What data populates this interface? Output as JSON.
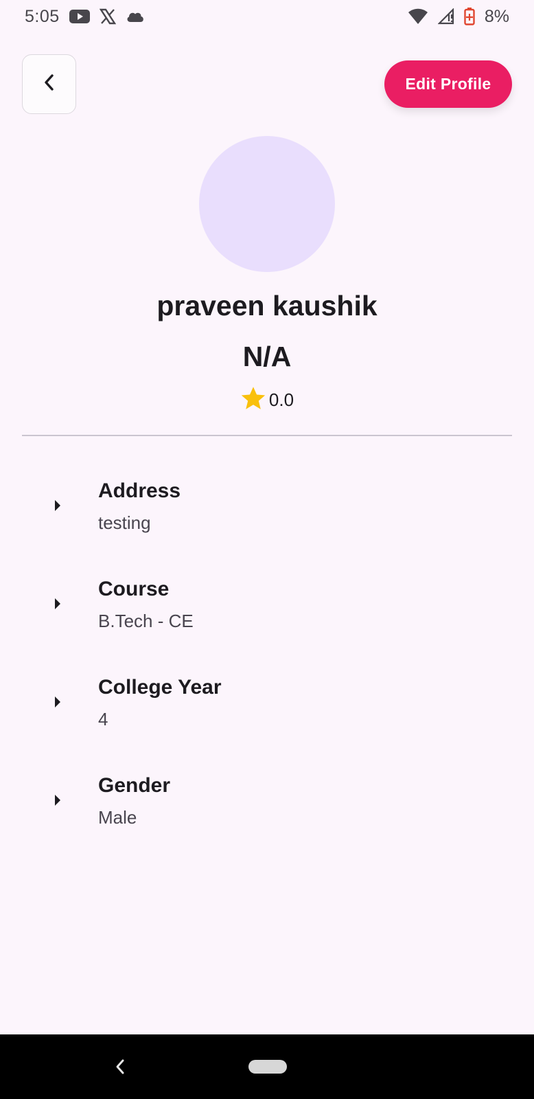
{
  "status_bar": {
    "time": "5:05",
    "battery_percent": "8%",
    "icons": [
      "youtube-icon",
      "x-icon",
      "cloud-icon",
      "wifi-icon",
      "signal-icon",
      "battery-icon"
    ]
  },
  "header": {
    "back_icon": "chevron-left-icon",
    "edit_label": "Edit Profile"
  },
  "profile": {
    "name": "praveen kaushik",
    "subtitle": "N/A",
    "rating": "0.0"
  },
  "info": [
    {
      "label": "Address",
      "value": "testing"
    },
    {
      "label": "Course",
      "value": "B.Tech - CE"
    },
    {
      "label": "College Year",
      "value": "4"
    },
    {
      "label": "Gender",
      "value": "Male"
    }
  ],
  "colors": {
    "accent": "#ea1e63",
    "background": "#fcf5fc",
    "avatar": "#e9defd",
    "star": "#f9c00c"
  }
}
